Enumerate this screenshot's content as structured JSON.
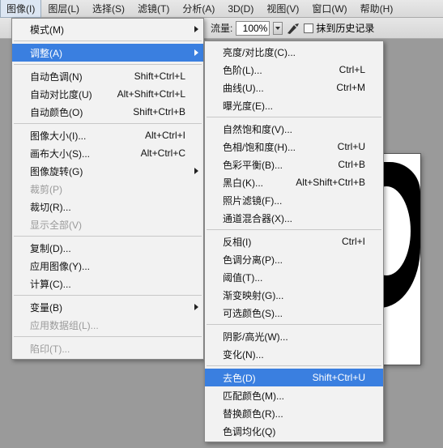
{
  "menubar": {
    "items": [
      "图像(I)",
      "图层(L)",
      "选择(S)",
      "滤镜(T)",
      "分析(A)",
      "3D(D)",
      "视图(V)",
      "窗口(W)",
      "帮助(H)"
    ],
    "active_index": 0
  },
  "toolbar": {
    "flow_label": "流量:",
    "flow_value": "100%",
    "history_label": "抹到历史记录"
  },
  "menu1": [
    {
      "label": "模式(M)",
      "submenu": true
    },
    {
      "sep": true
    },
    {
      "label": "调整(A)",
      "submenu": true,
      "highlight": true
    },
    {
      "sep": true
    },
    {
      "label": "自动色调(N)",
      "shortcut": "Shift+Ctrl+L"
    },
    {
      "label": "自动对比度(U)",
      "shortcut": "Alt+Shift+Ctrl+L"
    },
    {
      "label": "自动颜色(O)",
      "shortcut": "Shift+Ctrl+B"
    },
    {
      "sep": true
    },
    {
      "label": "图像大小(I)...",
      "shortcut": "Alt+Ctrl+I"
    },
    {
      "label": "画布大小(S)...",
      "shortcut": "Alt+Ctrl+C"
    },
    {
      "label": "图像旋转(G)",
      "submenu": true
    },
    {
      "label": "裁剪(P)",
      "disabled": true
    },
    {
      "label": "裁切(R)..."
    },
    {
      "label": "显示全部(V)",
      "disabled": true
    },
    {
      "sep": true
    },
    {
      "label": "复制(D)..."
    },
    {
      "label": "应用图像(Y)..."
    },
    {
      "label": "计算(C)..."
    },
    {
      "sep": true
    },
    {
      "label": "变量(B)",
      "submenu": true
    },
    {
      "label": "应用数据组(L)...",
      "disabled": true
    },
    {
      "sep": true
    },
    {
      "label": "陷印(T)...",
      "disabled": true
    }
  ],
  "menu2": [
    {
      "label": "亮度/对比度(C)..."
    },
    {
      "label": "色阶(L)...",
      "shortcut": "Ctrl+L"
    },
    {
      "label": "曲线(U)...",
      "shortcut": "Ctrl+M"
    },
    {
      "label": "曝光度(E)..."
    },
    {
      "sep": true
    },
    {
      "label": "自然饱和度(V)..."
    },
    {
      "label": "色相/饱和度(H)...",
      "shortcut": "Ctrl+U"
    },
    {
      "label": "色彩平衡(B)...",
      "shortcut": "Ctrl+B"
    },
    {
      "label": "黑白(K)...",
      "shortcut": "Alt+Shift+Ctrl+B"
    },
    {
      "label": "照片滤镜(F)..."
    },
    {
      "label": "通道混合器(X)..."
    },
    {
      "sep": true
    },
    {
      "label": "反相(I)",
      "shortcut": "Ctrl+I"
    },
    {
      "label": "色调分离(P)..."
    },
    {
      "label": "阈值(T)..."
    },
    {
      "label": "渐变映射(G)..."
    },
    {
      "label": "可选颜色(S)..."
    },
    {
      "sep": true
    },
    {
      "label": "阴影/高光(W)..."
    },
    {
      "label": "变化(N)..."
    },
    {
      "sep": true
    },
    {
      "label": "去色(D)",
      "shortcut": "Shift+Ctrl+U",
      "highlight": true
    },
    {
      "label": "匹配颜色(M)..."
    },
    {
      "label": "替换颜色(R)..."
    },
    {
      "label": "色调均化(Q)"
    }
  ]
}
